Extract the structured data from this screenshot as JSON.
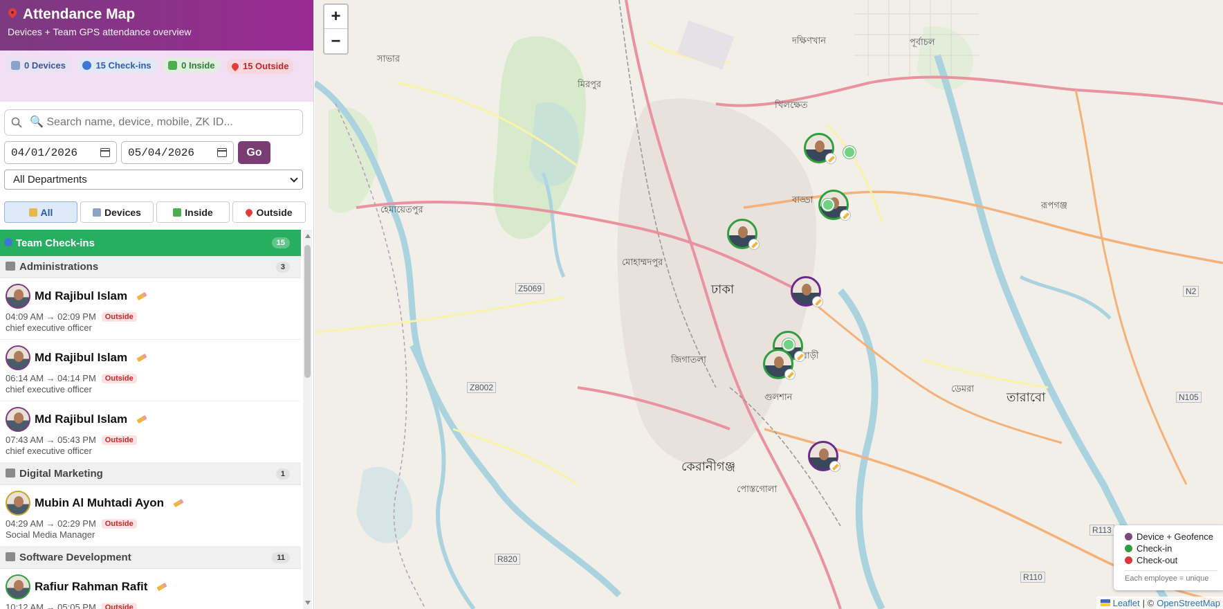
{
  "header": {
    "title": "Attendance Map",
    "subtitle": "Devices + Team GPS attendance overview"
  },
  "stats": {
    "devices": "0 Devices",
    "checkins": "15 Check-ins",
    "inside": "0 Inside",
    "outside": "15 Outside"
  },
  "search": {
    "placeholder": "🔍 Search name, device, mobile, ZK ID..."
  },
  "dates": {
    "from": "04/01/2026",
    "to": "05/04/2026",
    "go_label": "Go"
  },
  "department_select": {
    "selected": "All Departments"
  },
  "filters": [
    {
      "label": "All",
      "active": true
    },
    {
      "label": "Devices",
      "active": false
    },
    {
      "label": "Inside",
      "active": false
    },
    {
      "label": "Outside",
      "active": false
    }
  ],
  "list": {
    "section": {
      "title": "Team Check-ins",
      "count": "15"
    },
    "departments": [
      {
        "name": "Administrations",
        "count": "3",
        "employees": [
          {
            "name": "Md Rajibul Islam",
            "times": "04:09 AM → 02:09 PM",
            "status": "Outside",
            "role": "chief executive officer"
          },
          {
            "name": "Md Rajibul Islam",
            "times": "06:14 AM → 04:14 PM",
            "status": "Outside",
            "role": "chief executive officer"
          },
          {
            "name": "Md Rajibul Islam",
            "times": "07:43 AM → 05:43 PM",
            "status": "Outside",
            "role": "chief executive officer"
          }
        ]
      },
      {
        "name": "Digital Marketing",
        "count": "1",
        "employees": [
          {
            "name": "Mubin Al Muhtadi Ayon",
            "times": "04:29 AM → 02:29 PM",
            "status": "Outside",
            "role": "Social Media Manager"
          }
        ]
      },
      {
        "name": "Software Development",
        "count": "11",
        "employees": [
          {
            "name": "Rafiur Rahman Rafit",
            "times": "10:12 AM → 05:05 PM",
            "status": "Outside",
            "role": ""
          }
        ]
      }
    ]
  },
  "map": {
    "zoom_in": "+",
    "zoom_out": "−",
    "labels": {
      "dhaka": "ঢাকা",
      "savar": "সাভার",
      "mirpur": "মিরপুর",
      "gulshan": "গুলশান",
      "keraniganj": "কেরানীগঞ্জ",
      "rupganj": "রূপগঞ্জ",
      "tarabo": "তারাবো",
      "purbachal": "পূর্বাচল",
      "uttara": "দক্ষিণখান",
      "badda": "বাড্ডা",
      "khilkhet": "খিলক্ষেত",
      "demra": "ডেমরা",
      "mohammadpur": "মোহাম্মদপুর",
      "dhanmondi": "জিগাতলা",
      "postogola": "পোস্তগোলা",
      "jatrabari": "যাত্রাবাড়ী",
      "hemayetpur": "হেমায়েতপুর",
      "z5069": "Z5069",
      "z8002": "Z8002",
      "r820": "R820",
      "r110": "R110",
      "r113": "R113",
      "n2": "N2",
      "n105": "N105"
    },
    "legend": {
      "device": "Device + Geofence",
      "checkin": "Check-in",
      "checkout": "Check-out",
      "note": "Each employee = unique"
    },
    "attribution": {
      "leaflet": "Leaflet",
      "sep": "| ©",
      "osm": "OpenStreetMap"
    },
    "colors": {
      "device": "#7b4a7b",
      "checkin": "#2e9e3e",
      "checkout": "#d9363e"
    }
  }
}
